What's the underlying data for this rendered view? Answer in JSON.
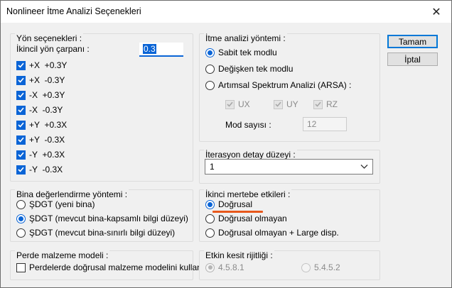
{
  "window": {
    "title": "Nonlineer İtme Analizi Seçenekleri",
    "close_glyph": "✕"
  },
  "buttons": {
    "ok": "Tamam",
    "cancel": "İptal"
  },
  "direction_options": {
    "title": "Yön seçenekleri :",
    "secondary_factor_label": "İkincil yön çarpanı :",
    "secondary_factor_value": "0.3",
    "items": [
      {
        "label": "+X  +0.3Y",
        "checked": true
      },
      {
        "label": "+X  -0.3Y",
        "checked": true
      },
      {
        "label": "-X  +0.3Y",
        "checked": true
      },
      {
        "label": "-X  -0.3Y",
        "checked": true
      },
      {
        "label": "+Y  +0.3X",
        "checked": true
      },
      {
        "label": "+Y  -0.3X",
        "checked": true
      },
      {
        "label": "-Y  +0.3X",
        "checked": true
      },
      {
        "label": "-Y  -0.3X",
        "checked": true
      }
    ]
  },
  "analysis_method": {
    "title": "İtme analizi yöntemi :",
    "options": [
      {
        "label": "Sabit tek modlu",
        "selected": true
      },
      {
        "label": "Değişken tek modlu",
        "selected": false
      },
      {
        "label": "Artımsal Spektrum Analizi (ARSA) :",
        "selected": false
      }
    ],
    "arsa_components": [
      {
        "label": "UX",
        "checked": true
      },
      {
        "label": "UY",
        "checked": true
      },
      {
        "label": "RZ",
        "checked": true
      }
    ],
    "mode_count_label": "Mod sayısı :",
    "mode_count_value": "12"
  },
  "iteration": {
    "title": "İterasyon detay düzeyi :",
    "selected": "1"
  },
  "evaluation_method": {
    "title": "Bina değerlendirme yöntemi :",
    "options": [
      {
        "label": "ŞDGT (yeni bina)",
        "selected": false
      },
      {
        "label": "ŞDGT (mevcut bina-kapsamlı bilgi düzeyi)",
        "selected": true
      },
      {
        "label": "ŞDGT (mevcut bina-sınırlı bilgi düzeyi)",
        "selected": false
      }
    ]
  },
  "second_order": {
    "title": "İkinci mertebe etkileri :",
    "options": [
      {
        "label": "Doğrusal",
        "selected": true
      },
      {
        "label": "Doğrusal olmayan",
        "selected": false
      },
      {
        "label": "Doğrusal olmayan + Large disp.",
        "selected": false
      }
    ],
    "accent_color": "#e8581c"
  },
  "wall_material": {
    "title": "Perde malzeme modeli :",
    "checkbox_label": "Perdelerde doğrusal malzeme modelini kullan",
    "checked": false
  },
  "section_stiffness": {
    "title": "Etkin kesit rijitliği :",
    "options": [
      {
        "label": "4.5.8.1",
        "selected": true
      },
      {
        "label": "5.4.5.2",
        "selected": false
      }
    ]
  },
  "colors": {
    "accent": "#0a64d6",
    "dialog_bg": "#f0f0f0"
  }
}
